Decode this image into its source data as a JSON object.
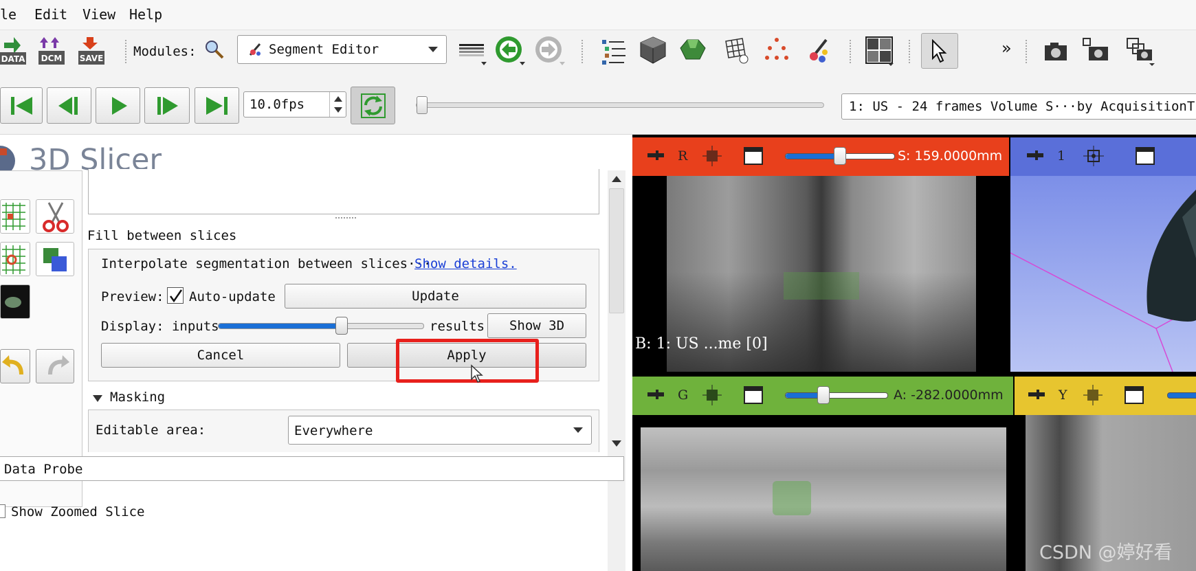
{
  "menu": {
    "file": "le",
    "edit": "Edit",
    "view": "View",
    "help": "Help"
  },
  "toolbar": {
    "data_label": "DATA",
    "dcm_label": "DCM",
    "save_label": "SAVE",
    "modules_label": "Modules:",
    "module_selected": "Segment Editor",
    "more_label": "»"
  },
  "playback": {
    "fps": "10.0fps",
    "sequence": "1: US - 24 frames Volume S···by AcquisitionTime"
  },
  "app": {
    "logo_text": "3D Slicer"
  },
  "fill_between": {
    "section_title": "Fill between slices",
    "description": "Interpolate segmentation between slices···",
    "details_link": "Show details.",
    "preview_label": "Preview:",
    "auto_update_label": "Auto-update",
    "auto_update_checked": true,
    "update_button": "Update",
    "display_label": "Display: inputs",
    "results_label": "results",
    "display_slider_fraction": 0.6,
    "show3d_button": "Show 3D",
    "cancel_button": "Cancel",
    "apply_button": "Apply"
  },
  "masking": {
    "title": "Masking",
    "editable_area_label": "Editable area:",
    "editable_area_value": "Everywhere"
  },
  "data_probe": {
    "title": "Data Probe",
    "show_zoomed_label": "Show Zoomed Slice"
  },
  "views": {
    "red": {
      "letter": "R",
      "offset": "S: 159.0000mm",
      "overlay": "B: 1: US ...me [0]",
      "color": "#e8401c",
      "slider_fraction": 0.5
    },
    "three_d": {
      "letter": "1",
      "color": "#5a6fd9"
    },
    "green": {
      "letter": "G",
      "offset": "A: -282.0000mm",
      "color": "#6fb23c",
      "slider_fraction": 0.37
    },
    "yellow": {
      "letter": "Y",
      "color": "#e7c52f"
    }
  },
  "watermark": "CSDN @婷好看",
  "colors": {
    "highlight": "#e8201c",
    "link": "#1a3fd6",
    "slider": "#1a6fd6"
  }
}
